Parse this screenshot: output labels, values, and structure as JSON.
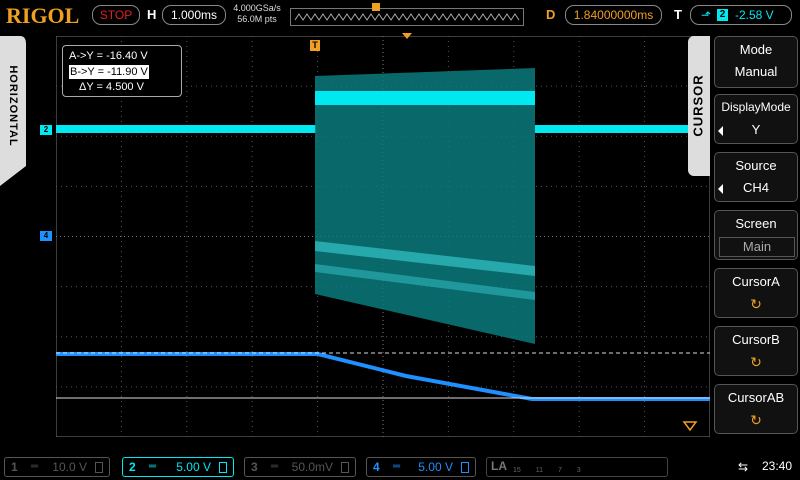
{
  "brand": "RIGOL",
  "status": "STOP",
  "horizontal": {
    "label": "H",
    "timebase": "1.000ms",
    "sample_rate": "4.000GSa/s",
    "mem_depth": "56.0M pts"
  },
  "delay": {
    "label": "D",
    "value": "1.84000000ms"
  },
  "trigger": {
    "label": "T",
    "source_channel": "2",
    "level": "-2.58 V",
    "edge_symbol": "⬏"
  },
  "left_tab": "HORIZONTAL",
  "cursor_readout": {
    "a": "A->Y = -16.40 V",
    "b": "B->Y = -11.90 V",
    "delta": "ΔY =  4.500 V"
  },
  "channel_markers": {
    "ch2": "2",
    "ch4": "4",
    "trigger_marker": "T"
  },
  "menu": {
    "title": "CURSOR",
    "items": [
      {
        "label": "Mode",
        "value": "Manual"
      },
      {
        "label": "DisplayMode",
        "value": "Y"
      },
      {
        "label": "Source",
        "value": "CH4"
      },
      {
        "label": "Screen",
        "value": "Main"
      },
      {
        "label": "CursorA",
        "value": "↻"
      },
      {
        "label": "CursorB",
        "value": "↻"
      },
      {
        "label": "CursorAB",
        "value": "↻"
      }
    ]
  },
  "channels": [
    {
      "num": "1",
      "coupling": "═",
      "scale": "10.0 V",
      "color": "#555555"
    },
    {
      "num": "2",
      "coupling": "═",
      "scale": "5.00 V",
      "color": "#00e8f0"
    },
    {
      "num": "3",
      "coupling": "═",
      "scale": "50.0mV",
      "color": "#555555"
    },
    {
      "num": "4",
      "coupling": "═",
      "scale": "5.00 V",
      "color": "#1e90ff"
    }
  ],
  "logic_analyzer": {
    "label": "LA",
    "groups": "15 11 7 3"
  },
  "usb_icon": "usb-icon",
  "clock": "23:40",
  "colors": {
    "ch2": "#00e8f0",
    "ch4": "#1e90ff",
    "accent": "#f0a020",
    "stop": "#e02020"
  }
}
